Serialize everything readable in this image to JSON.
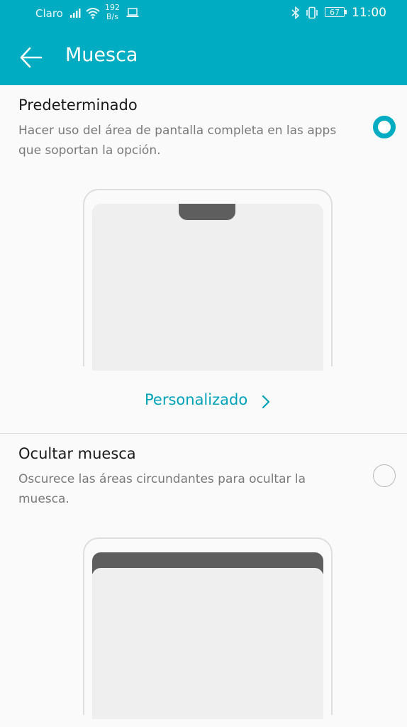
{
  "status_bar": {
    "carrier": "Claro",
    "speed_value": "192",
    "speed_unit": "B/s",
    "battery": "67",
    "time": "11:00",
    "icons": [
      "signal-icon",
      "wifi-icon",
      "laptop-icon",
      "bluetooth-icon",
      "vibrate-icon",
      "battery-icon"
    ]
  },
  "toolbar": {
    "title": "Muesca",
    "back_icon": "back-arrow-icon"
  },
  "options": [
    {
      "title": "Predeterminado",
      "description": "Hacer uso del área de pantalla completa en las apps que soportan la opción.",
      "selected": true
    },
    {
      "title": "Ocultar muesca",
      "description": "Oscurece las áreas circundantes para ocultar la muesca.",
      "selected": false
    }
  ],
  "custom_link": {
    "label": "Personalizado",
    "icon": "chevron-right-icon"
  },
  "colors": {
    "accent": "#00acc1",
    "link": "#00a2b8",
    "notch": "#5e5e5e"
  }
}
